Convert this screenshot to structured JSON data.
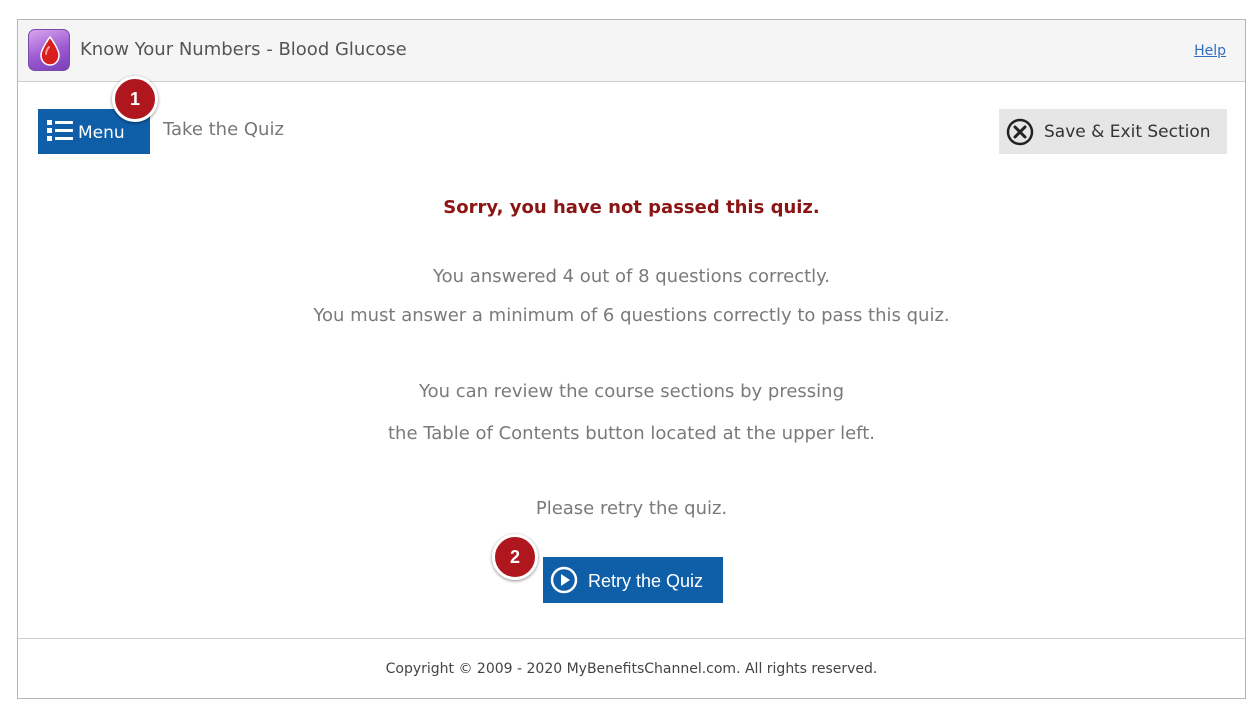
{
  "header": {
    "app_icon": "blood-drop-icon",
    "title": "Know Your Numbers - Blood Glucose",
    "help_label": "Help"
  },
  "toolbar": {
    "menu_label": "Menu",
    "menu_icon": "list-icon",
    "breadcrumb": "Take the Quiz",
    "save_exit_label": "Save & Exit Section",
    "save_exit_icon": "close-circle-icon"
  },
  "callouts": {
    "badge_1": "1",
    "badge_2": "2"
  },
  "result": {
    "heading": "Sorry, you have not passed this quiz.",
    "score_line": "You answered 4 out of 8 questions correctly.",
    "requirement_line": "You must answer a minimum of 6 questions correctly to pass this quiz.",
    "review_line_1": "You can review the course sections by pressing",
    "review_line_2": "the Table of Contents button located at the upper left.",
    "retry_prompt": "Please retry the quiz.",
    "retry_label": "Retry the Quiz",
    "retry_icon": "play-circle-icon"
  },
  "footer": {
    "copyright": "Copyright © 2009 - 2020 MyBenefitsChannel.com. All rights reserved."
  },
  "colors": {
    "primary_blue": "#0f5ea8",
    "error_red": "#8b1414",
    "badge_red": "#b0161d",
    "app_icon_purple": "#9b5ad0"
  }
}
